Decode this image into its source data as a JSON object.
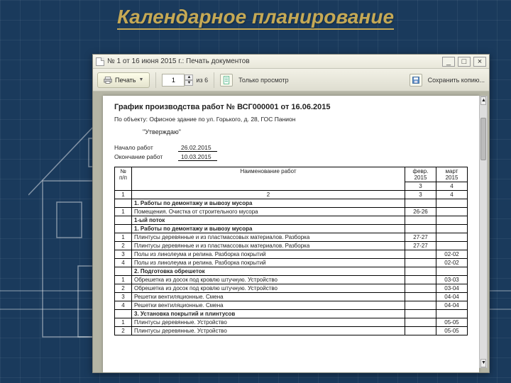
{
  "slide": {
    "title": "Календарное планирование"
  },
  "window": {
    "title": "№ 1 от 16 июня 2015 г.: Печать документов"
  },
  "toolbar": {
    "print_label": "Печать",
    "page_value": "1",
    "page_of": "из 6",
    "view_only_label": "Только просмотр",
    "save_label": "Сохранить копию..."
  },
  "doc": {
    "title": "График производства работ № ВСГ000001 от 16.06.2015",
    "object_line": "По объекту: Офисное здание по ул. Горького, д. 28, ГОС Панион",
    "approved": "\"Утверждаю\"",
    "start_label": "Начало работ",
    "start_value": "26.02.2015",
    "end_label": "Окончание работ",
    "end_value": "10.03.2015",
    "columns": {
      "num": "№ п/п",
      "name": "Наименование работ",
      "month1_top": "февр.",
      "month1_bot": "2015",
      "month2_top": "март",
      "month2_bot": "2015",
      "idx1": "1",
      "idx2": "2",
      "idx3": "3",
      "idx4": "4"
    },
    "rows": [
      {
        "num": "",
        "name": "1. Работы по демонтажу и вывозу мусора",
        "m1": "",
        "m2": "",
        "bold": true
      },
      {
        "num": "1",
        "name": "Помещения. Очистка от строительного мусора",
        "m1": "26-26",
        "m2": ""
      },
      {
        "num": "",
        "name": "1-ый поток",
        "m1": "",
        "m2": "",
        "bold": true
      },
      {
        "num": "",
        "name": "1. Работы по демонтажу и вывозу мусора",
        "m1": "",
        "m2": "",
        "bold": true
      },
      {
        "num": "1",
        "name": "Плинтусы деревянные и из пластмассовых материалов. Разборка",
        "m1": "27-27",
        "m2": ""
      },
      {
        "num": "2",
        "name": "Плинтусы деревянные и из пластмассовых материалов. Разборка",
        "m1": "27-27",
        "m2": ""
      },
      {
        "num": "3",
        "name": "Полы из линолеума и релина. Разборка покрытий",
        "m1": "",
        "m2": "02-02"
      },
      {
        "num": "4",
        "name": "Полы из линолеума и релина. Разборка покрытий",
        "m1": "",
        "m2": "02-02"
      },
      {
        "num": "",
        "name": "2. Подготовка обрешеток",
        "m1": "",
        "m2": "",
        "bold": true
      },
      {
        "num": "1",
        "name": "Обрешетка из досок под кровлю штучную. Устройство",
        "m1": "",
        "m2": "03-03"
      },
      {
        "num": "2",
        "name": "Обрешетка из досок под кровлю штучную. Устройство",
        "m1": "",
        "m2": "03-04"
      },
      {
        "num": "3",
        "name": "Решетки вентиляционные. Смена",
        "m1": "",
        "m2": "04-04"
      },
      {
        "num": "4",
        "name": "Решетки вентиляционные. Смена",
        "m1": "",
        "m2": "04-04"
      },
      {
        "num": "",
        "name": "3. Установка покрытий и плинтусов",
        "m1": "",
        "m2": "",
        "bold": true
      },
      {
        "num": "1",
        "name": "Плинтусы деревянные. Устройство",
        "m1": "",
        "m2": "05-05"
      },
      {
        "num": "2",
        "name": "Плинтусы деревянные. Устройство",
        "m1": "",
        "m2": "05-05"
      }
    ]
  }
}
